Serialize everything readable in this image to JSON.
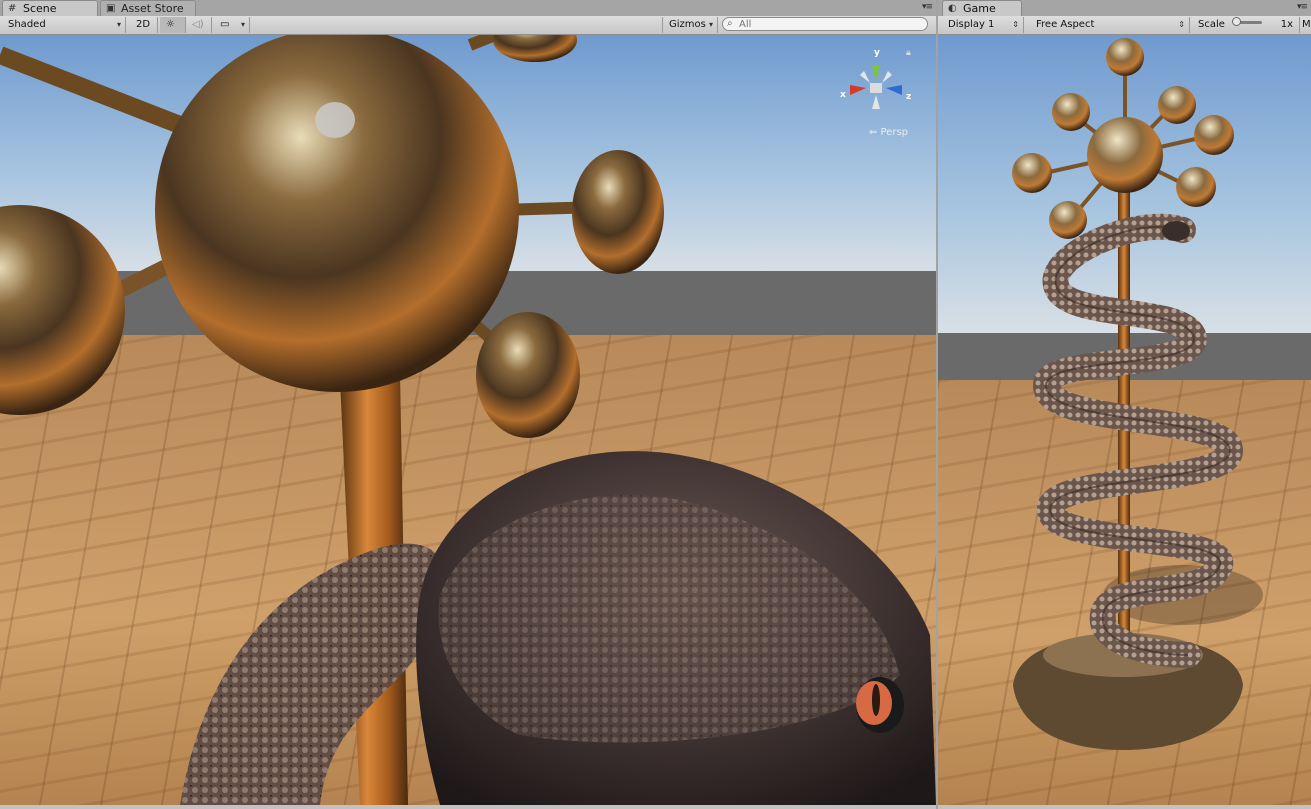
{
  "scene": {
    "tab_scene": "Scene",
    "tab_asset_store": "Asset Store",
    "shading_mode": "Shaded",
    "btn_2d": "2D",
    "gizmos_label": "Gizmos",
    "search_placeholder": "All",
    "projection_label": "Persp",
    "axis_x": "x",
    "axis_y": "y",
    "axis_z": "z"
  },
  "game": {
    "tab_game": "Game",
    "display": "Display 1",
    "aspect": "Free Aspect",
    "scale_label": "Scale",
    "scale_value": "1x",
    "maximize_label": "M"
  },
  "colors": {
    "accent_x": "#d43a2a",
    "accent_y": "#7cc43a",
    "accent_z": "#2f6ad4"
  }
}
